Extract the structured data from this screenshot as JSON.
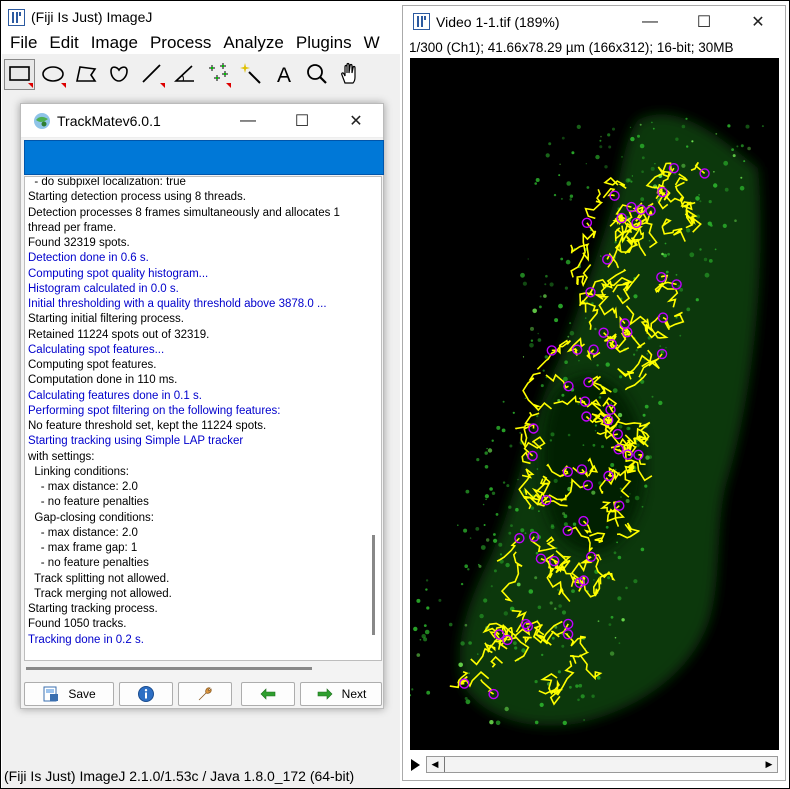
{
  "imagej": {
    "title": "(Fiji Is Just) ImageJ",
    "menus": [
      "File",
      "Edit",
      "Image",
      "Process",
      "Analyze",
      "Plugins",
      "W"
    ],
    "tools": [
      {
        "name": "rectangle-tool-icon"
      },
      {
        "name": "oval-tool-icon"
      },
      {
        "name": "polygon-tool-icon"
      },
      {
        "name": "freehand-tool-icon"
      },
      {
        "name": "line-tool-icon"
      },
      {
        "name": "angle-tool-icon"
      },
      {
        "name": "multipoint-tool-icon"
      },
      {
        "name": "wand-tool-icon"
      },
      {
        "name": "text-tool-icon"
      },
      {
        "name": "magnifier-tool-icon"
      },
      {
        "name": "hand-tool-icon"
      }
    ],
    "text_tool_glyph": "A",
    "status": "(Fiji Is Just) ImageJ 2.1.0/1.53c / Java 1.8.0_172 (64-bit)"
  },
  "trackmate": {
    "title": "TrackMatev6.0.1",
    "log": [
      {
        "text": "  - do subpixel localization: true",
        "blue": false
      },
      {
        "text": "Starting detection process using 8 threads.",
        "blue": false
      },
      {
        "text": "Detection processes 8 frames simultaneously and allocates 1",
        "blue": false
      },
      {
        "text": "thread per frame.",
        "blue": false
      },
      {
        "text": "Found 32319 spots.",
        "blue": false
      },
      {
        "text": "Detection done in 0.6 s.",
        "blue": true
      },
      {
        "text": "Computing spot quality histogram...",
        "blue": true
      },
      {
        "text": "Histogram calculated in 0.0 s.",
        "blue": true
      },
      {
        "text": "Initial thresholding with a quality threshold above 3878.0 ...",
        "blue": true
      },
      {
        "text": "Starting initial filtering process.",
        "blue": false
      },
      {
        "text": "Retained 11224 spots out of 32319.",
        "blue": false
      },
      {
        "text": "Calculating spot features...",
        "blue": true
      },
      {
        "text": "Computing spot features.",
        "blue": false
      },
      {
        "text": "Computation done in 110 ms.",
        "blue": false
      },
      {
        "text": "Calculating features done in 0.1 s.",
        "blue": true
      },
      {
        "text": "Performing spot filtering on the following features:",
        "blue": true
      },
      {
        "text": "No feature threshold set, kept the 11224 spots.",
        "blue": false
      },
      {
        "text": "Starting tracking using Simple LAP tracker",
        "blue": true
      },
      {
        "text": "with settings:",
        "blue": false
      },
      {
        "text": "  Linking conditions:",
        "blue": false
      },
      {
        "text": "    - max distance: 2.0",
        "blue": false
      },
      {
        "text": "    - no feature penalties",
        "blue": false
      },
      {
        "text": "  Gap-closing conditions:",
        "blue": false
      },
      {
        "text": "    - max distance: 2.0",
        "blue": false
      },
      {
        "text": "    - max frame gap: 1",
        "blue": false
      },
      {
        "text": "    - no feature penalties",
        "blue": false
      },
      {
        "text": "  Track splitting not allowed.",
        "blue": false
      },
      {
        "text": "  Track merging not allowed.",
        "blue": false
      },
      {
        "text": "Starting tracking process.",
        "blue": false
      },
      {
        "text": "Found 1050 tracks.",
        "blue": false
      },
      {
        "text": "Tracking done in 0.2 s.",
        "blue": true
      }
    ],
    "buttons": {
      "save": "Save",
      "next": "Next"
    }
  },
  "image_window": {
    "title": "Video 1-1.tif (189%)",
    "info": "1/300 (Ch1); 41.66x78.29 µm (166x312); 16-bit; 30MB"
  },
  "colors": {
    "progress_blue": "#0078d7",
    "log_blue": "#0000cc",
    "track_yellow": "#ffff00",
    "spot_magenta": "#c000ff",
    "cell_green": "#1f8a1f"
  }
}
